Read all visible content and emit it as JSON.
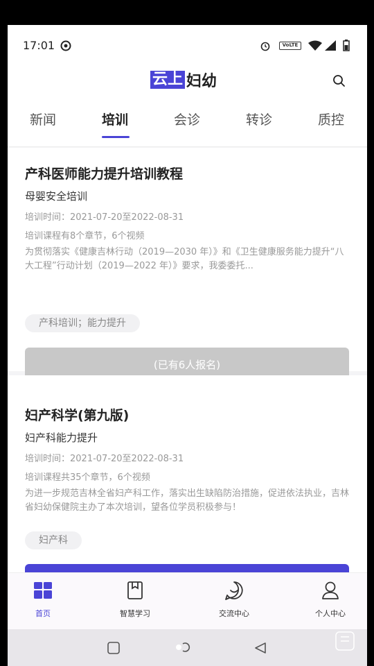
{
  "status_bar": {
    "time": "17:01",
    "volte_label": "VoLTE"
  },
  "header": {
    "logo_part1": "云上",
    "logo_part2": "妇幼"
  },
  "tabs": [
    {
      "label": "新闻"
    },
    {
      "label": "培训",
      "active": true
    },
    {
      "label": "会诊"
    },
    {
      "label": "转诊"
    },
    {
      "label": "质控"
    }
  ],
  "courses": [
    {
      "title": "产科医师能力提升培训教程",
      "subtitle": "母婴安全培训",
      "time": "培训时间：2021-07-20至2022-08-31",
      "chapters": "培训课程有8个章节，6个视频",
      "description": "为贯彻落实《健康吉林行动（2019—2030 年）》和《卫生健康服务能力提升“八大工程”行动计划（2019—2022 年）》要求，我委委托...",
      "tag": "产科培训；能力提升",
      "button": "(已有6人报名)"
    },
    {
      "title": "妇产科学(第九版)",
      "subtitle": "妇产科能力提升",
      "time": "培训时间：2021-07-20至2022-08-31",
      "chapters": "培训课程共35个章节，6个视频",
      "description": "为进一步规范吉林全省妇产科工作，落实出生缺陷防治措施，促进依法执业，吉林省妇幼保健院主办了本次培训，望各位学员积极参与！",
      "tag": "妇产科"
    }
  ],
  "bottom_nav": [
    {
      "label": "首页",
      "icon": "home-grid-icon",
      "active": true
    },
    {
      "label": "智慧学习",
      "icon": "book-icon"
    },
    {
      "label": "交流中心",
      "icon": "chat-icon"
    },
    {
      "label": "个人中心",
      "icon": "person-icon"
    }
  ],
  "colors": {
    "accent": "#4a44d6",
    "disabled_button": "#c8c8c8"
  }
}
